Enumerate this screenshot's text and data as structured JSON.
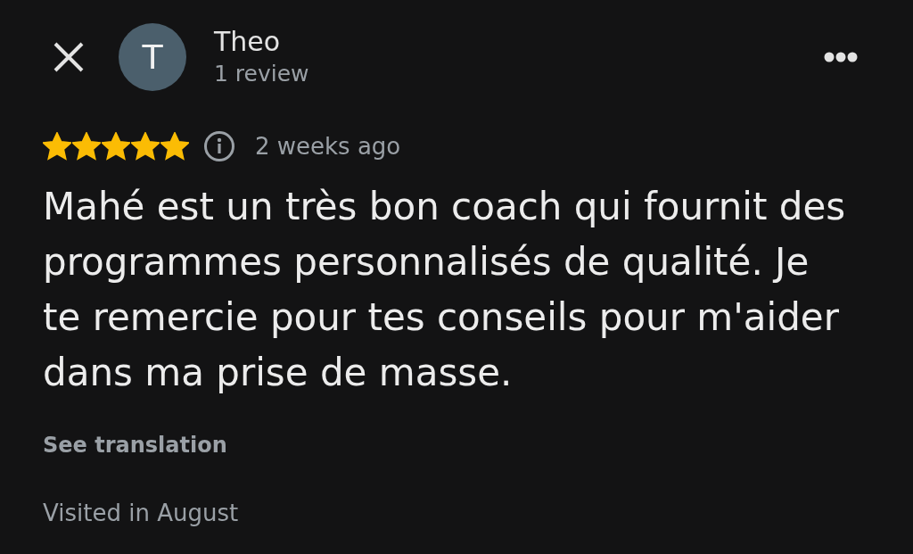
{
  "header": {
    "avatar_letter": "T",
    "name": "Theo",
    "review_count": "1 review"
  },
  "review": {
    "stars": 5,
    "time": "2 weeks ago",
    "text": "Mahé est un très bon coach qui fournit des programmes personnalisés de qualité. Je te remercie pour tes conseils pour m'aider dans ma prise de masse.",
    "see_translation": "See translation",
    "visited": "Visited in August"
  }
}
